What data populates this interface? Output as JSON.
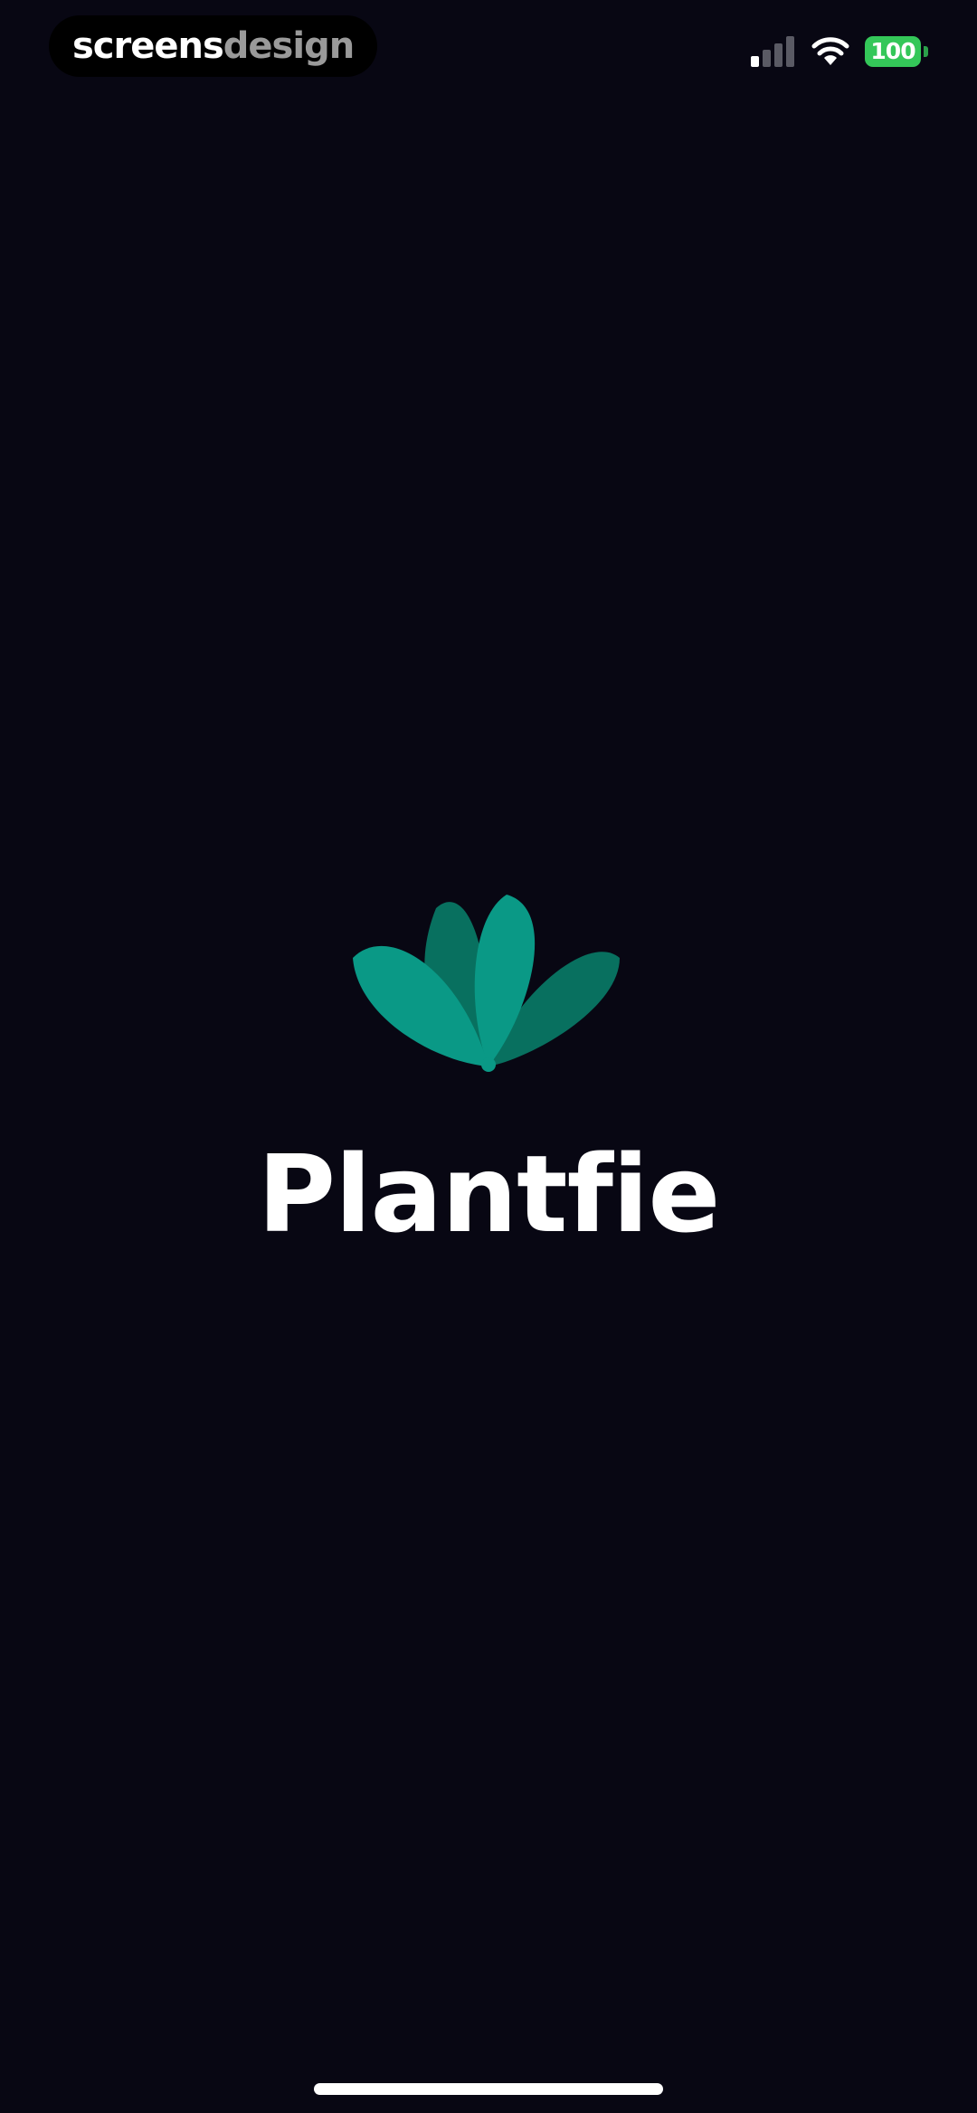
{
  "status_bar": {
    "watermark": {
      "part1": "screens",
      "part2": "design"
    },
    "battery_level": "100",
    "signal_icon": "cellular-signal-icon",
    "wifi_icon": "wifi-icon"
  },
  "splash": {
    "logo_icon": "plant-leaves-logo-icon",
    "app_name": "Plantfie"
  },
  "colors": {
    "background": "#080713",
    "leaf_light": "#0a9986",
    "leaf_dark": "#08705f",
    "battery": "#34c759",
    "text": "#ffffff"
  }
}
